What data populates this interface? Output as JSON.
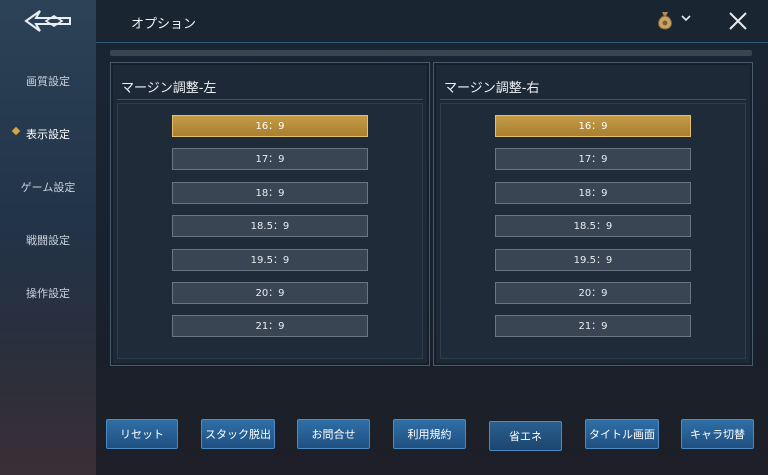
{
  "header": {
    "title": "オプション"
  },
  "sidebar": {
    "items": [
      {
        "label": "画質設定"
      },
      {
        "label": "表示設定"
      },
      {
        "label": "ゲーム設定"
      },
      {
        "label": "戦闘設定"
      },
      {
        "label": "操作設定"
      }
    ],
    "active_index": 1
  },
  "panels": {
    "left": {
      "title": "マージン調整-左",
      "options": [
        "16：9",
        "17：9",
        "18：9",
        "18.5：9",
        "19.5：9",
        "20：9",
        "21：9"
      ],
      "selected": "16：9"
    },
    "right": {
      "title": "マージン調整-右",
      "options": [
        "16：9",
        "17：9",
        "18：9",
        "18.5：9",
        "19.5：9",
        "20：9",
        "21：9"
      ],
      "selected": "16：9"
    }
  },
  "footer": {
    "buttons": [
      "リセット",
      "スタック脱出",
      "お問合せ",
      "利用規約",
      "省エネ",
      "タイトル画面",
      "キャラ切替"
    ]
  },
  "colors": {
    "accent_gold": "#c49b44",
    "button_blue": "#2f6fa8"
  },
  "icons": {
    "back": "back-arrow-icon",
    "currency": "money-bag-icon",
    "close": "close-icon"
  }
}
